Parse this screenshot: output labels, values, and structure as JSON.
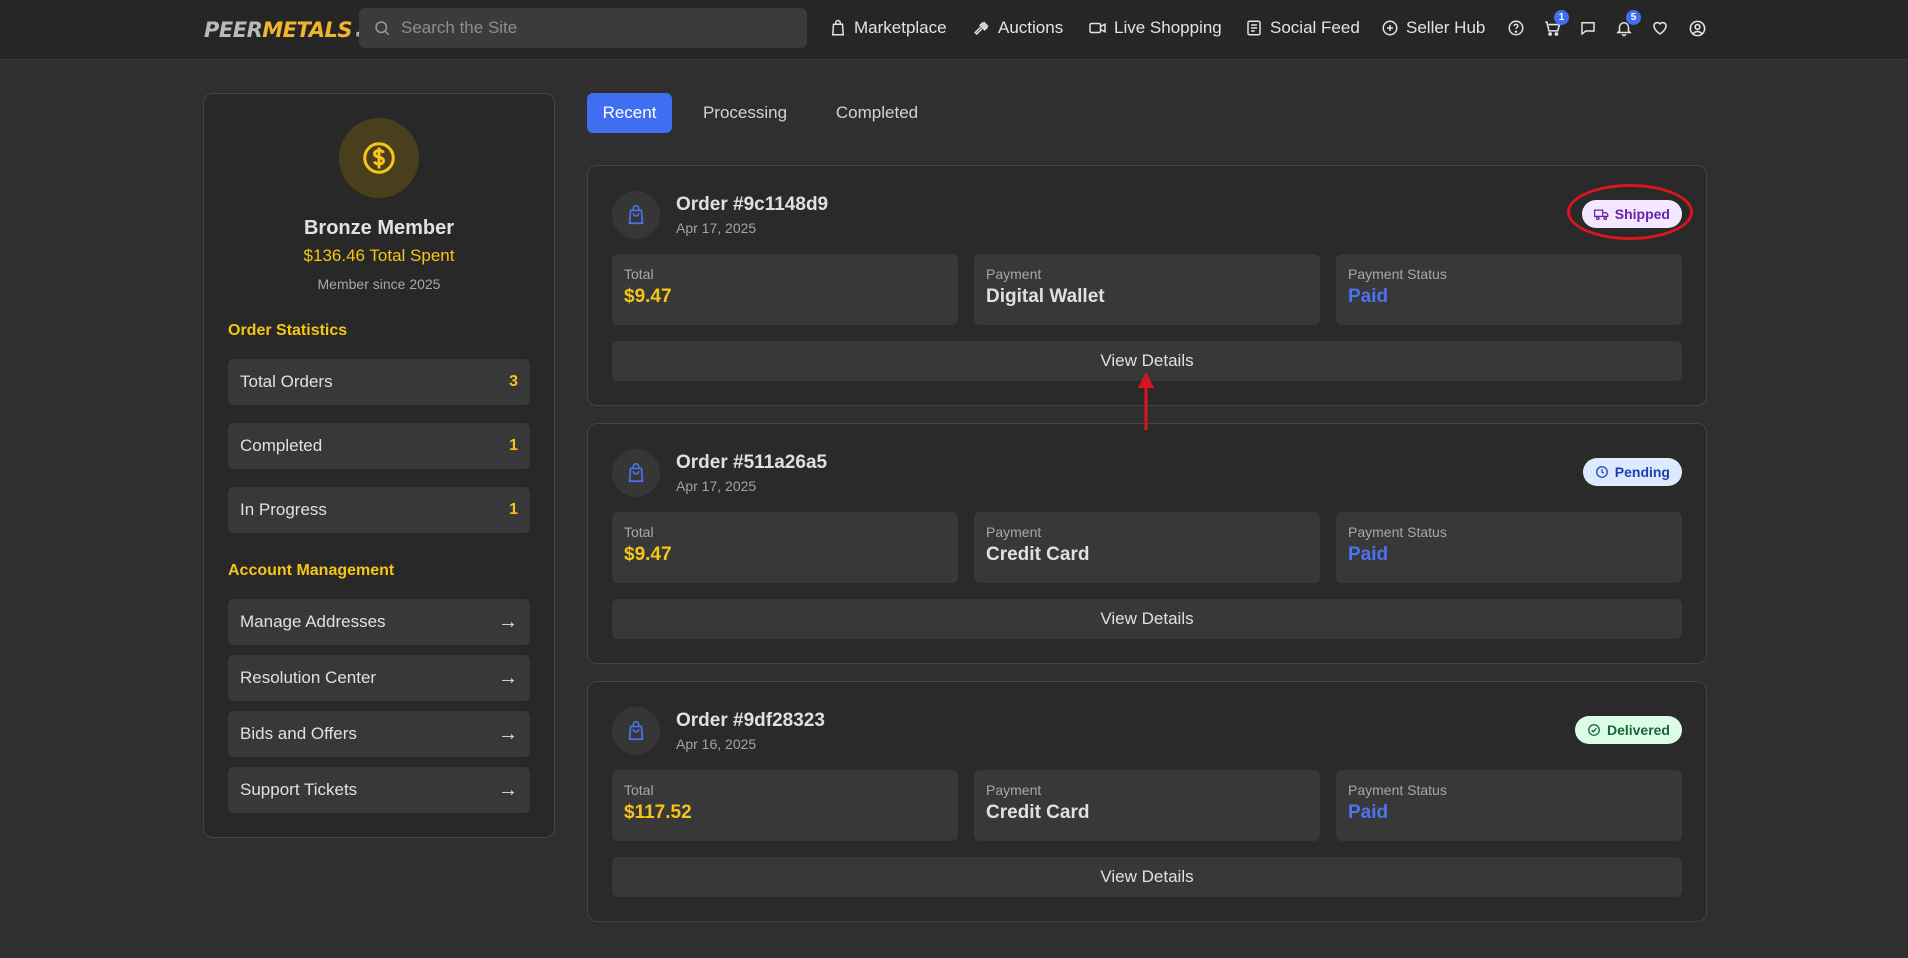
{
  "nav": {
    "logo_peer": "PEER",
    "logo_metals": "METALS",
    "search_placeholder": "Search the Site",
    "links": [
      "Marketplace",
      "Auctions",
      "Live Shopping",
      "Social Feed",
      "Seller Hub"
    ],
    "cart_badge": "1",
    "notifications_badge": "5",
    "accent": "#3f6ff0"
  },
  "sidebar": {
    "member_name": "Bronze Member",
    "total_spent": "$136.46 Total Spent",
    "member_since": "Member since 2025",
    "order_stats_title": "Order Statistics",
    "stats": [
      {
        "label": "Total Orders",
        "value": "3"
      },
      {
        "label": "Completed",
        "value": "1"
      },
      {
        "label": "In Progress",
        "value": "1"
      }
    ],
    "account_title": "Account Management",
    "account_items": [
      "Manage Addresses",
      "Resolution Center",
      "Bids and Offers",
      "Support Tickets"
    ],
    "arrow": "→"
  },
  "tabs": [
    "Recent",
    "Processing",
    "Completed"
  ],
  "active_tab": "Recent",
  "labels": {
    "total": "Total",
    "payment": "Payment",
    "payment_status": "Payment Status",
    "view_details": "View Details"
  },
  "orders": [
    {
      "number": "Order #9c1148d9",
      "date": "Apr 17, 2025",
      "status": "Shipped",
      "total": "$9.47",
      "payment": "Digital Wallet",
      "payment_status": "Paid"
    },
    {
      "number": "Order #511a26a5",
      "date": "Apr 17, 2025",
      "status": "Pending",
      "total": "$9.47",
      "payment": "Credit Card",
      "payment_status": "Paid"
    },
    {
      "number": "Order #9df28323",
      "date": "Apr 16, 2025",
      "status": "Delivered",
      "total": "$117.52",
      "payment": "Credit Card",
      "payment_status": "Paid"
    }
  ]
}
